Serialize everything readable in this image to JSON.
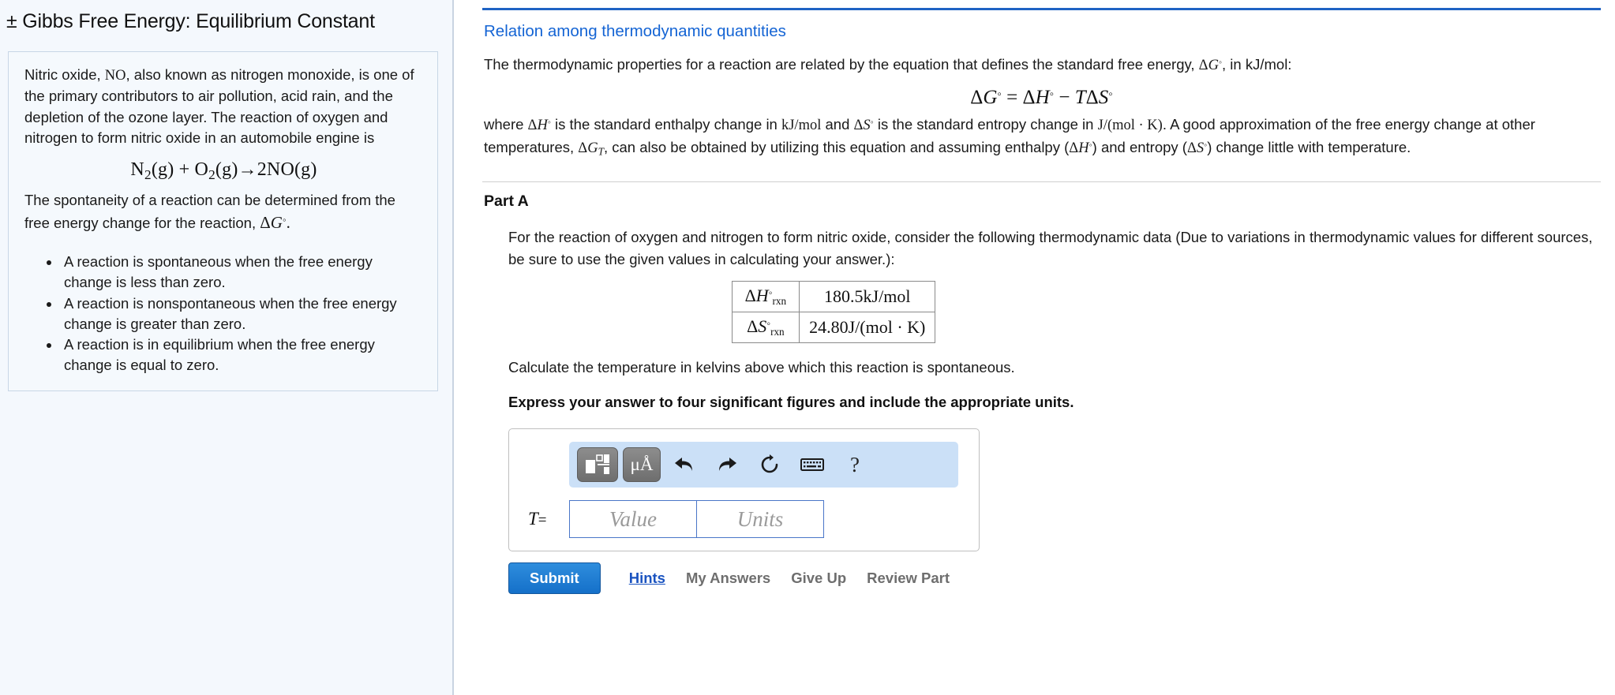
{
  "left": {
    "title": "± Gibbs Free Energy: Equilibrium Constant",
    "intro_p1_a": "Nitric oxide, ",
    "intro_p1_formula": "NO",
    "intro_p1_b": ", also known as nitrogen monoxide, is one of the primary contributors to air pollution, acid rain, and the depletion of the ozone layer. The reaction of oxygen and nitrogen to form nitric oxide in an automobile engine is",
    "reaction_equation": "N₂(g) + O₂(g)→2NO(g)",
    "intro_p2": "The spontaneity of a reaction can be determined from the free energy change for the reaction,",
    "delta_g_symbol": "ΔG°.",
    "bullets": [
      "A reaction is spontaneous when the free energy change is less than zero.",
      "A reaction is nonspontaneous when the free energy change is greater than zero.",
      "A reaction is in equilibrium when the free energy change is equal to zero."
    ]
  },
  "right": {
    "section_heading": "Relation among thermodynamic quantities",
    "intro_text_a": "The thermodynamic properties for a reaction are related by the equation that defines the standard free energy, ",
    "intro_text_sym": "ΔG°",
    "intro_text_b": ", in kJ/mol:",
    "main_equation": "ΔG° = ΔH° − TΔS°",
    "para_1": "where ",
    "para_sym_dh": "ΔH°",
    "para_2": " is the standard enthalpy change in ",
    "para_unit_kj": "kJ/mol",
    "para_3": " and ",
    "para_sym_ds": "ΔS°",
    "para_4": " is the standard entropy change in ",
    "para_unit_j": "J/(mol · K)",
    "para_5": ". A good approximation of the free energy change at other temperatures, ",
    "para_sym_gt": "ΔG_T",
    "para_6": ", can also be obtained by utilizing this equation and assuming enthalpy (",
    "para_sym_dh2": "ΔH°",
    "para_7": ") and entropy (",
    "para_sym_ds2": "ΔS°",
    "para_8": ") change little with temperature."
  },
  "part_a": {
    "label": "Part A",
    "question": "For the reaction of oxygen and nitrogen to form nitric oxide, consider the following thermodynamic data (Due to variations in thermodynamic values for different sources, be sure to use the given values in calculating your answer.):",
    "table": {
      "rows": [
        {
          "symbol": "ΔH°rxn",
          "value": "180.5kJ/mol"
        },
        {
          "symbol": "ΔS°rxn",
          "value": "24.80J/(mol · K)"
        }
      ]
    },
    "calculate": "Calculate the temperature in kelvins above which this reaction is spontaneous.",
    "express": "Express your answer to four significant figures and include the appropriate units."
  },
  "answer_widget": {
    "toolbar": {
      "layout_button": "template-layout",
      "units_button": "μÅ",
      "undo": "undo-arrow",
      "redo": "redo-arrow",
      "reset": "reset-circular-arrow",
      "keyboard": "keyboard",
      "help": "?"
    },
    "variable_label": "T",
    "equals": "=",
    "value_placeholder": "Value",
    "units_placeholder": "Units",
    "value_current": "",
    "units_current": ""
  },
  "actions": {
    "submit": "Submit",
    "hints": "Hints",
    "my_answers": "My Answers",
    "give_up": "Give Up",
    "review_part": "Review Part"
  },
  "colors": {
    "accent_blue": "#1464d4",
    "submit_blue": "#1570c9",
    "toolbar_blue": "#cbe0f7",
    "panel_bg": "#f4f8fd",
    "link_gray": "#6e6e6e"
  }
}
